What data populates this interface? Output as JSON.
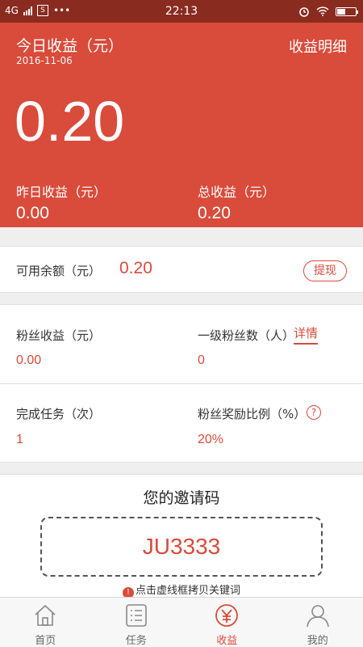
{
  "status_bar": {
    "network": "4G",
    "time": "22:13",
    "more": "•••"
  },
  "header": {
    "title": "今日收益（元）",
    "date": "2016-11-06",
    "detail_link": "收益明细",
    "today_amount": "0.20",
    "yesterday_label": "昨日收益（元）",
    "yesterday_value": "0.00",
    "total_label": "总收益（元）",
    "total_value": "0.20"
  },
  "balance": {
    "label": "可用余额（元）",
    "value": "0.20",
    "withdraw_label": "提现"
  },
  "stats": {
    "fan_income_label": "粉丝收益（元）",
    "fan_income_value": "0.00",
    "level1_fans_label": "一级粉丝数（人）",
    "level1_fans_detail": "详情",
    "level1_fans_value": "0",
    "tasks_label": "完成任务（次）",
    "tasks_value": "1",
    "reward_ratio_label": "粉丝奖励比例（%）",
    "reward_ratio_value": "20%",
    "help_glyph": "?"
  },
  "invite": {
    "heading": "您的邀请码",
    "code": "JU3333",
    "tip": "点击虚线框拷贝关键词",
    "tip_glyph": "!"
  },
  "tabbar": {
    "items": [
      {
        "label": "首页",
        "icon": "home-icon"
      },
      {
        "label": "任务",
        "icon": "task-list-icon"
      },
      {
        "label": "收益",
        "icon": "yen-icon",
        "active": true
      },
      {
        "label": "我的",
        "icon": "user-icon"
      }
    ]
  },
  "colors": {
    "accent": "#d94b3b",
    "status_bar": "#8a2b1f"
  }
}
